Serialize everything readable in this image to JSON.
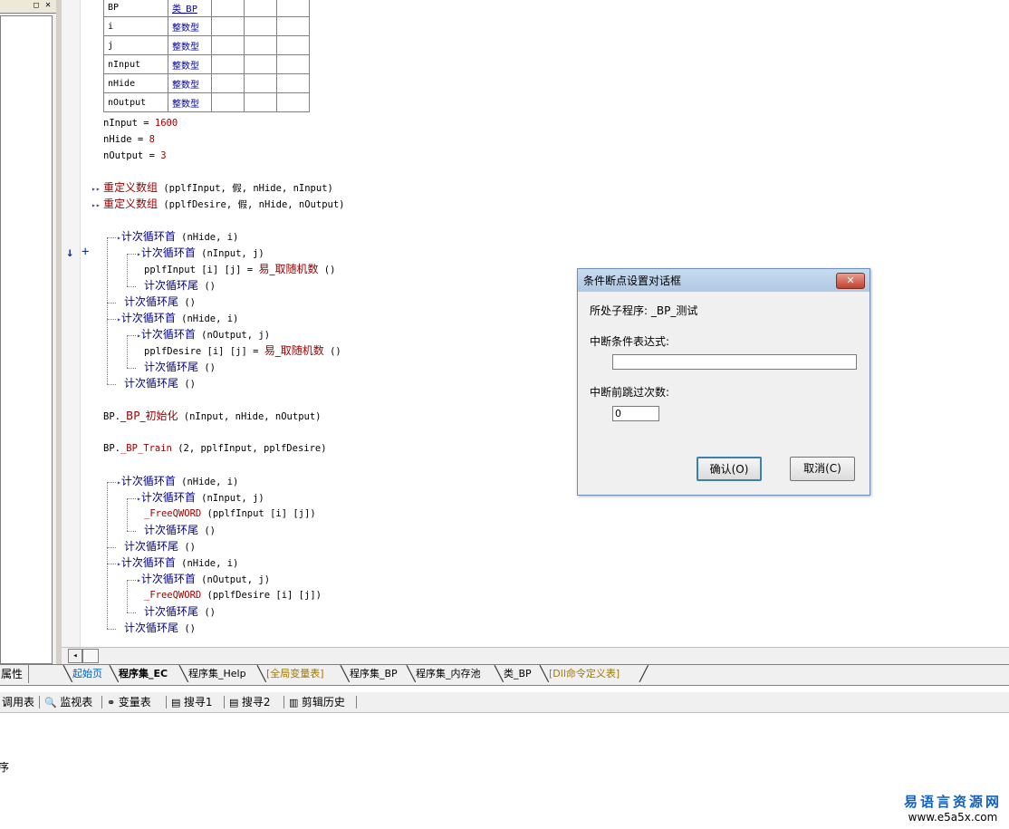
{
  "variables": [
    {
      "name": "BP",
      "type": "类_BP"
    },
    {
      "name": "i",
      "type": "整数型"
    },
    {
      "name": "j",
      "type": "整数型"
    },
    {
      "name": "nInput",
      "type": "整数型"
    },
    {
      "name": "nHide",
      "type": "整数型"
    },
    {
      "name": "nOutput",
      "type": "整数型"
    }
  ],
  "code": {
    "l1a": "nInput = ",
    "l1b": "1600",
    "l2a": "nHide = ",
    "l2b": "8",
    "l3a": "nOutput = ",
    "l3b": "3",
    "redim1_kw": "重定义数组",
    "redim1_args": " (pplfInput, 假, nHide, nInput)",
    "redim2_kw": "重定义数组",
    "redim2_args": " (pplfDesire, 假, nHide, nOutput)",
    "loop_start": "计次循环首",
    "loop_end": "计次循环尾",
    "a1": " (nHide, i)",
    "a2": " (nInput, j)",
    "assign1a": "pplfInput [i] [j] = ",
    "rand": "易_取随机数",
    "empty": " ()",
    "a3": " (nHide, i)",
    "a4": " (nOutput, j)",
    "assign2a": "pplfDesire [i] [j] = ",
    "init_a": "BP.",
    "init_b": "_BP_初始化",
    "init_c": " (nInput, nHide, nOutput)",
    "train_a": "BP.",
    "train_b": "_BP_Train",
    "train_c": " (2, pplfInput, pplfDesire)",
    "b1": " (nHide, i)",
    "b2": " (nInput, j)",
    "free": "_FreeQWORD",
    "free1": " (pplfInput [i] [j])",
    "b3": " (nHide, i)",
    "b4": " (nOutput, j)",
    "free2": " (pplfDesire [i] [j])",
    "margin_arrow": "↓",
    "margin_plus": "+"
  },
  "tabs": {
    "properties": "属性",
    "items": [
      "起始页",
      "程序集_EC",
      "程序集_Help",
      "[全局变量表]",
      "程序集_BP",
      "程序集_内存池",
      "类_BP",
      "[Dll命令定义表]"
    ]
  },
  "toolbar": {
    "items": [
      "调用表",
      "监视表",
      "变量表",
      "搜寻1",
      "搜寻2",
      "剪辑历史"
    ]
  },
  "output": {
    "fragment": "序"
  },
  "watermark": {
    "line1": "易语言资源网",
    "line2": "www.e5a5x.com"
  },
  "dialog": {
    "title": "条件断点设置对话框",
    "close": "✕",
    "subprogram_label": "所处子程序: _BP_测试",
    "condition_label": "中断条件表达式:",
    "condition_value": "",
    "skip_label": "中断前跳过次数:",
    "skip_value": "0",
    "ok": "确认(O)",
    "cancel": "取消(C)"
  }
}
